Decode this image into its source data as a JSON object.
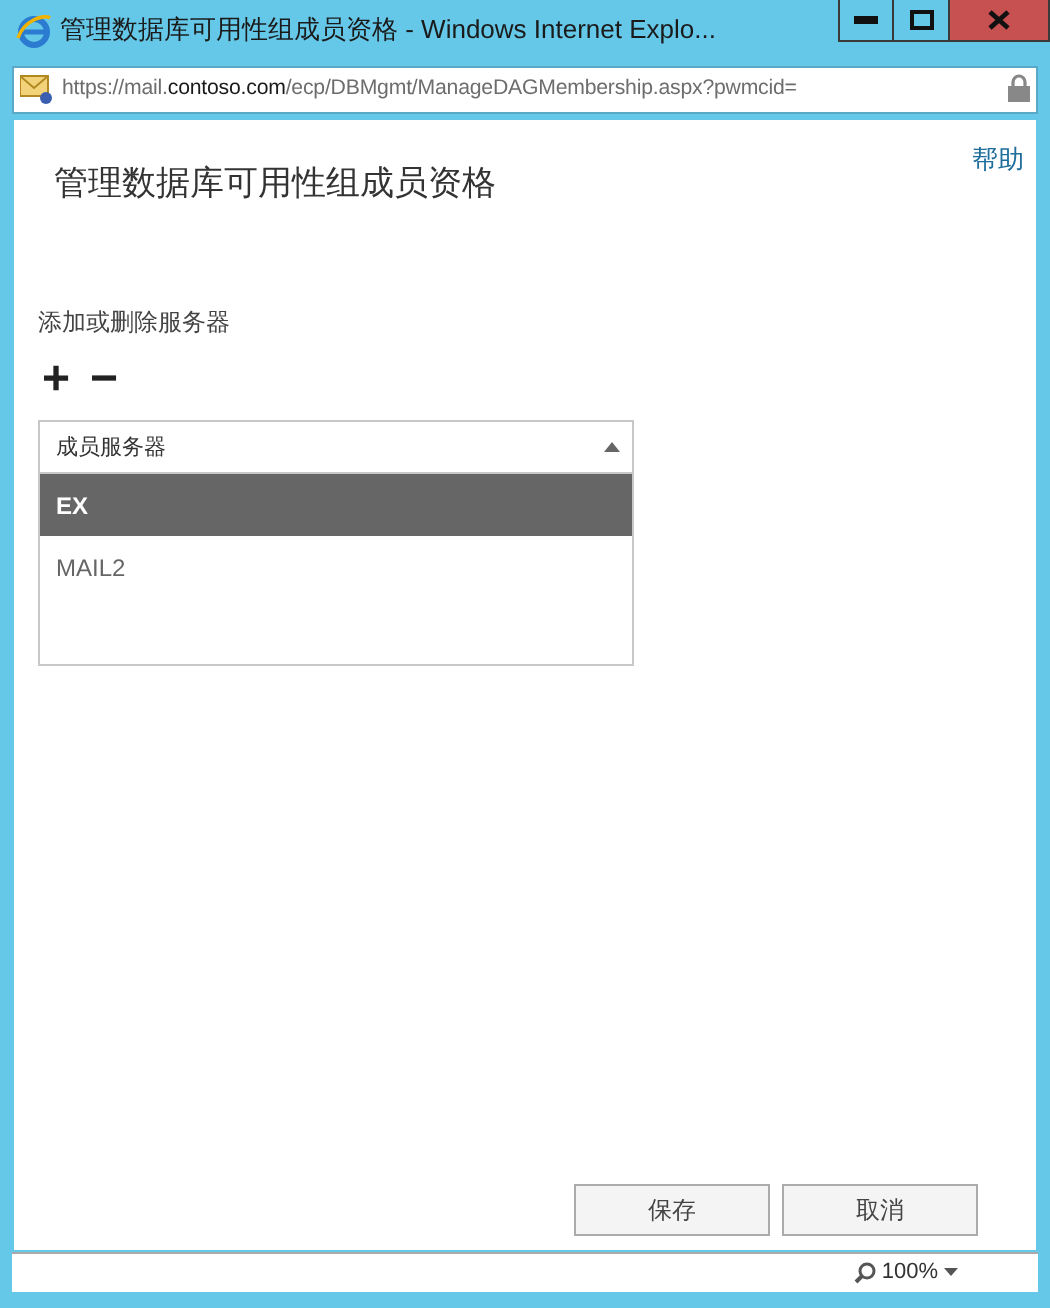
{
  "window": {
    "title": "管理数据库可用性组成员资格 - Windows Internet Explo..."
  },
  "address_bar": {
    "segments": [
      {
        "text": "https://mail.",
        "emphasis": false
      },
      {
        "text": "contoso.com",
        "emphasis": true
      },
      {
        "text": "/ecp/DBMgmt/ManageDAGMembership.aspx?pwmcid=",
        "emphasis": false
      }
    ]
  },
  "help_link": "帮助",
  "page_title": "管理数据库可用性组成员资格",
  "section_label": "添加或删除服务器",
  "toolbar": [
    "+",
    "−"
  ],
  "table": {
    "columns": [
      {
        "label": "成员服务器"
      }
    ],
    "rows": [
      {
        "name": "EX",
        "selected": true
      },
      {
        "name": "MAIL2",
        "selected": false
      }
    ]
  },
  "buttons": [
    {
      "label": "保存"
    },
    {
      "label": "取消"
    }
  ],
  "status_bar": {
    "zoom": "100%"
  }
}
